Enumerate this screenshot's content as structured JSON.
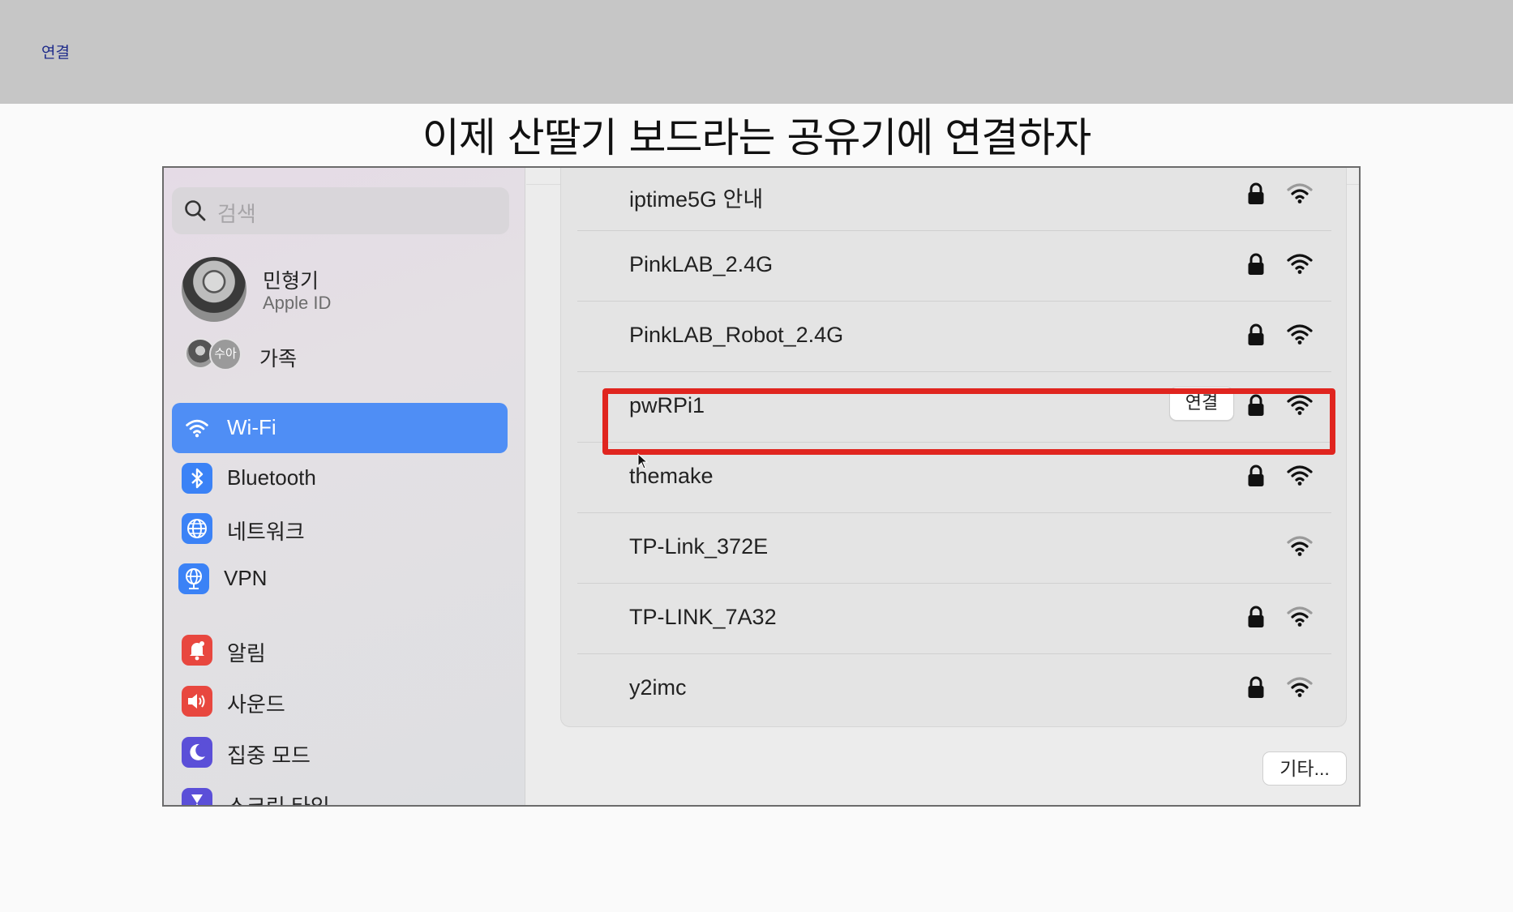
{
  "topbar": {
    "label": "연결"
  },
  "slide": {
    "title": "이제 산딸기 보드라는 공유기에 연결하자"
  },
  "sidebar": {
    "search_placeholder": "검색",
    "profile": {
      "name": "민형기",
      "subtitle": "Apple ID"
    },
    "family": {
      "badge": "수아",
      "label": "가족"
    },
    "items": [
      {
        "label": "Wi-Fi",
        "icon": "wifi-icon",
        "selected": true
      },
      {
        "label": "Bluetooth",
        "icon": "bluetooth-icon"
      },
      {
        "label": "네트워크",
        "icon": "globe-icon"
      },
      {
        "label": "VPN",
        "icon": "vpn-globe-icon"
      },
      {
        "label": "알림",
        "icon": "bell-icon"
      },
      {
        "label": "사운드",
        "icon": "speaker-icon"
      },
      {
        "label": "집중 모드",
        "icon": "moon-icon"
      },
      {
        "label": "스크린 타임",
        "icon": "hourglass-icon"
      }
    ]
  },
  "networks": [
    {
      "name": "iptime5G 안내",
      "locked": true
    },
    {
      "name": "PinkLAB_2.4G",
      "locked": true
    },
    {
      "name": "PinkLAB_Robot_2.4G",
      "locked": true
    },
    {
      "name": "pwRPi1",
      "locked": true,
      "connect_label": "연결",
      "highlighted": true
    },
    {
      "name": "themake",
      "locked": true
    },
    {
      "name": "TP-Link_372E",
      "locked": false
    },
    {
      "name": "TP-LINK_7A32",
      "locked": true
    },
    {
      "name": "y2imc",
      "locked": true
    }
  ],
  "other_button": "기타...",
  "colors": {
    "accent": "#4f8ef5",
    "highlight": "#e0251f"
  }
}
